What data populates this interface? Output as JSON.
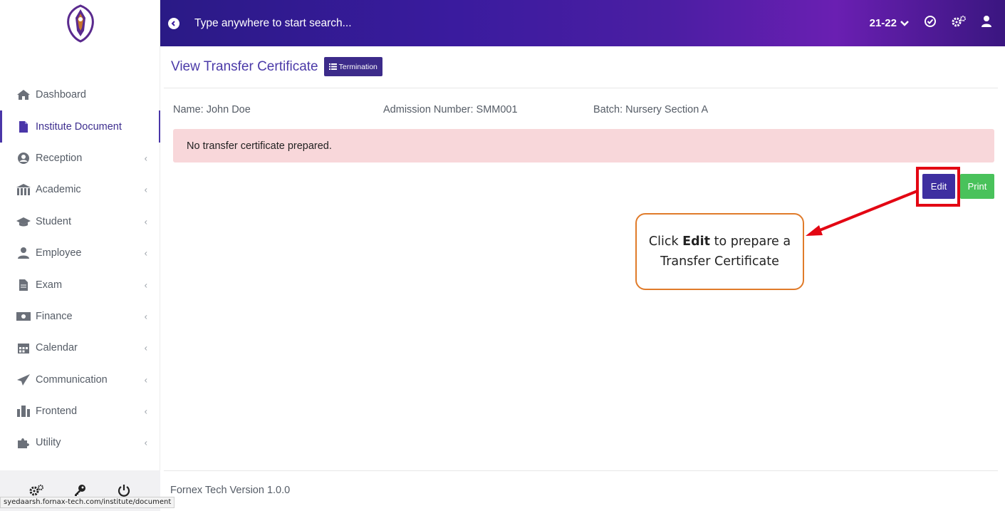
{
  "colors": {
    "brand": "#3e2fa0",
    "topbar_start": "#2a1a86",
    "topbar_end": "#6a1fb2",
    "alert_bg": "#f8d7da",
    "print_green": "#49c25b",
    "highlight_red": "#e30613",
    "callout_border": "#e07b2a"
  },
  "topbar": {
    "search_placeholder": "Type anywhere to start search...",
    "academic_year": "21-22"
  },
  "sidebar": {
    "items": [
      {
        "label": "Dashboard",
        "icon": "home-icon",
        "has_chevron": false
      },
      {
        "label": "Institute Document",
        "icon": "document-icon",
        "has_chevron": false,
        "active": true
      },
      {
        "label": "Reception",
        "icon": "user-circle-icon",
        "has_chevron": true
      },
      {
        "label": "Academic",
        "icon": "institution-icon",
        "has_chevron": true
      },
      {
        "label": "Student",
        "icon": "graduation-cap-icon",
        "has_chevron": true
      },
      {
        "label": "Employee",
        "icon": "employee-icon",
        "has_chevron": true
      },
      {
        "label": "Exam",
        "icon": "file-icon",
        "has_chevron": true
      },
      {
        "label": "Finance",
        "icon": "money-icon",
        "has_chevron": true
      },
      {
        "label": "Calendar",
        "icon": "calendar-icon",
        "has_chevron": true
      },
      {
        "label": "Communication",
        "icon": "send-icon",
        "has_chevron": true
      },
      {
        "label": "Frontend",
        "icon": "building-icon",
        "has_chevron": true
      },
      {
        "label": "Utility",
        "icon": "puzzle-icon",
        "has_chevron": true
      }
    ],
    "chevron": "‹",
    "footer_icons": [
      "settings-icon",
      "key-icon",
      "power-icon"
    ]
  },
  "status_url": "syedaarsh.fornax-tech.com/institute/document",
  "main": {
    "title": "View Transfer Certificate",
    "termination_label": "Termination",
    "name": "Name: John Doe",
    "admission_number": "Admission Number: SMM001",
    "batch": "Batch: Nursery Section A",
    "alert_text": "No transfer certificate prepared.",
    "edit_label": "Edit",
    "print_label": "Print"
  },
  "callout": {
    "before": "Click ",
    "bold": "Edit",
    "after": " to prepare a Transfer Certificate"
  },
  "footer": {
    "version": "Fornex Tech Version 1.0.0"
  }
}
